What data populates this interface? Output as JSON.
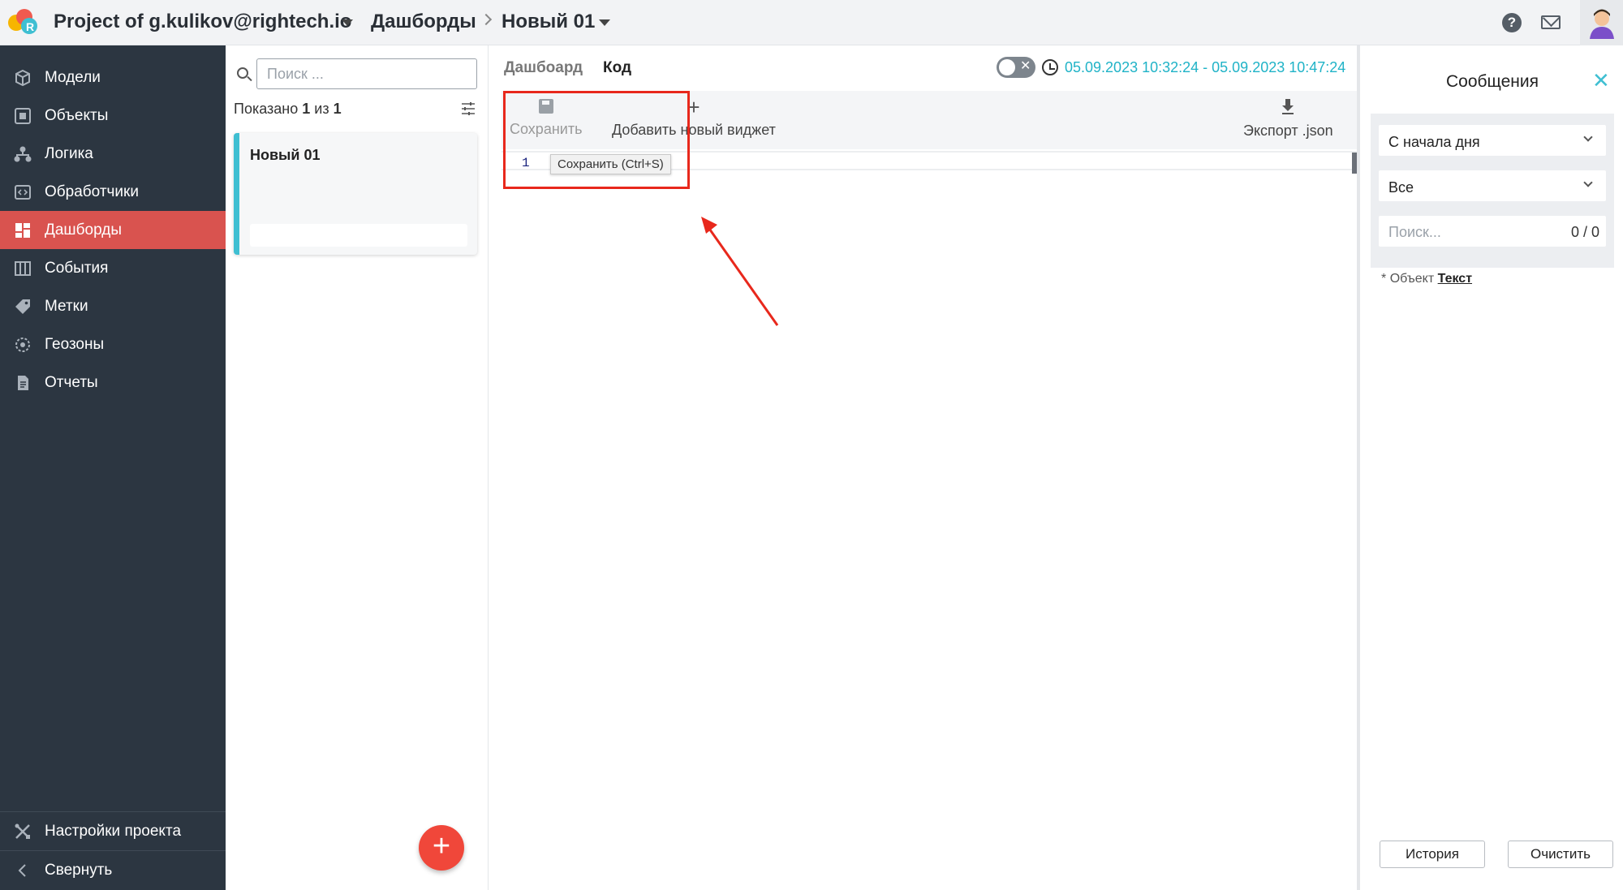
{
  "header": {
    "project": "Project of g.kulikov@rightech.io",
    "breadcrumb_section": "Дашборды",
    "breadcrumb_item": "Новый 01"
  },
  "sidebar": {
    "items": [
      {
        "label": "Модели",
        "icon": "cube-icon"
      },
      {
        "label": "Объекты",
        "icon": "object-icon"
      },
      {
        "label": "Логика",
        "icon": "logic-tree-icon"
      },
      {
        "label": "Обработчики",
        "icon": "code-icon"
      },
      {
        "label": "Дашборды",
        "icon": "dashboard-icon",
        "active": true
      },
      {
        "label": "События",
        "icon": "events-icon"
      },
      {
        "label": "Метки",
        "icon": "tag-icon"
      },
      {
        "label": "Геозоны",
        "icon": "geozone-icon"
      },
      {
        "label": "Отчеты",
        "icon": "report-icon"
      }
    ],
    "settings_label": "Настройки проекта",
    "collapse_label": "Свернуть"
  },
  "list": {
    "search_placeholder": "Поиск ...",
    "shown_prefix": "Показано",
    "shown_count": "1",
    "shown_of": "из",
    "shown_total": "1",
    "card_title": "Новый 01",
    "add_label": "+"
  },
  "main": {
    "tabs": [
      "Дашбоард",
      "Код"
    ],
    "daterange": "05.09.2023 10:32:24 - 05.09.2023 10:47:24",
    "toolbar": {
      "save_label": "Сохранить",
      "add_widget_label": "Добавить новый виджет",
      "export_label": "Экспорт .json"
    },
    "editor": {
      "line_number": "1",
      "tooltip": "Сохранить (Ctrl+S)"
    }
  },
  "messages_panel": {
    "title": "Сообщения",
    "period_select": "С начала дня",
    "type_select": "Все",
    "search_placeholder": "Поиск...",
    "search_count": "0 / 0",
    "legend_star": "*",
    "legend_object": "Объект",
    "legend_text": "Текст",
    "history_button": "История",
    "clear_button": "Очистить"
  },
  "colors": {
    "accent_active": "#d9534f",
    "sidebar_bg": "#2c3641",
    "teal": "#20b3c7",
    "fab": "#f0473a",
    "annotation_red": "#e8281c"
  }
}
